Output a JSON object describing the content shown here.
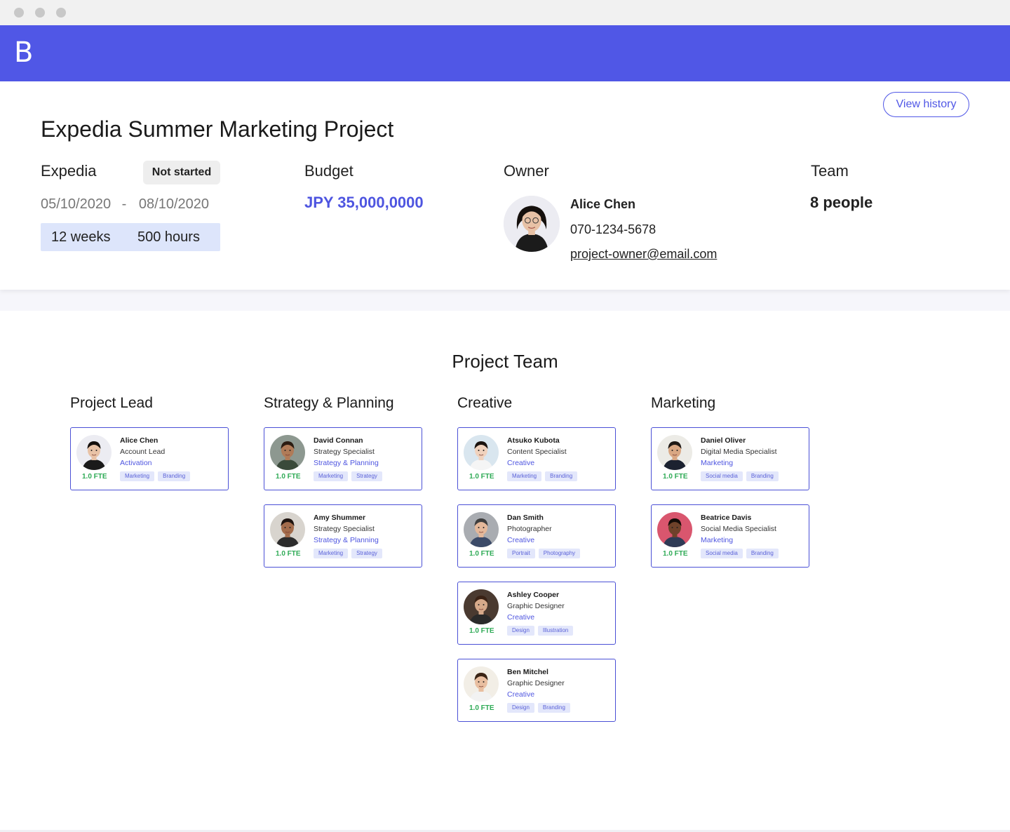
{
  "app": {
    "logo_letter": "B"
  },
  "header": {
    "view_history_label": "View history",
    "title": "Expedia Summer Marketing Project",
    "client": "Expedia",
    "status": "Not started",
    "start_date": "05/10/2020",
    "date_separator": "-",
    "end_date": "08/10/2020",
    "duration_weeks": "12 weeks",
    "duration_hours": "500 hours",
    "budget_label": "Budget",
    "budget_value": "JPY 35,000,0000",
    "owner_label": "Owner",
    "owner_name": "Alice Chen",
    "owner_phone": "070-1234-5678",
    "owner_email": "project-owner@email.com",
    "team_label": "Team",
    "team_count": "8 people"
  },
  "team_section": {
    "title": "Project Team",
    "groups": [
      {
        "name": "Project Lead"
      },
      {
        "name": "Strategy & Planning"
      },
      {
        "name": "Creative"
      },
      {
        "name": "Marketing"
      }
    ],
    "members": [
      {
        "name": "Alice Chen",
        "role": "Account Lead",
        "dept": "Activation",
        "fte": "1.0 FTE",
        "tags": [
          "Marketing",
          "Branding"
        ],
        "skin": "#e8c2a6",
        "hair": "#15100d",
        "shirt": "#1b1b1b",
        "bg": "#ececf2"
      },
      {
        "name": "David Connan",
        "role": "Strategy Specialist",
        "dept": "Strategy & Planning",
        "fte": "1.0 FTE",
        "tags": [
          "Marketing",
          "Strategy"
        ],
        "skin": "#b07b58",
        "hair": "#2b1c12",
        "shirt": "#3a4a3a",
        "bg": "#8d9890"
      },
      {
        "name": "Amy Shummer",
        "role": "Strategy Specialist",
        "dept": "Strategy & Planning",
        "fte": "1.0 FTE",
        "tags": [
          "Marketing",
          "Strategy"
        ],
        "skin": "#a36c4c",
        "hair": "#1e1410",
        "shirt": "#2c2c2c",
        "bg": "#d8d4ce"
      },
      {
        "name": "Atsuko Kubota",
        "role": "Content Specialist",
        "dept": "Creative",
        "fte": "1.0 FTE",
        "tags": [
          "Marketing",
          "Branding"
        ],
        "skin": "#f0d2bd",
        "hair": "#1a120e",
        "shirt": "#f5f5f5",
        "bg": "#d9e6ef"
      },
      {
        "name": "Dan Smith",
        "role": "Photographer",
        "dept": "Creative",
        "fte": "1.0 FTE",
        "tags": [
          "Portrait",
          "Photography"
        ],
        "skin": "#e4b89a",
        "hair": "#3e3e3e",
        "shirt": "#3b4a68",
        "bg": "#a9acb1"
      },
      {
        "name": "Ashley Cooper",
        "role": "Graphic Designer",
        "dept": "Creative",
        "fte": "1.0 FTE",
        "tags": [
          "Design",
          "Illustration"
        ],
        "skin": "#d6a98a",
        "hair": "#3a2215",
        "shirt": "#2a2a2a",
        "bg": "#4a3a30"
      },
      {
        "name": "Ben Mitchel",
        "role": "Graphic Designer",
        "dept": "Creative",
        "fte": "1.0 FTE",
        "tags": [
          "Design",
          "Branding"
        ],
        "skin": "#e8bea0",
        "hair": "#3a2415",
        "shirt": "#f2f2f2",
        "bg": "#f2eee6"
      },
      {
        "name": "Daniel Oliver",
        "role": "Digital Media Specialist",
        "dept": "Marketing",
        "fte": "1.0 FTE",
        "tags": [
          "Social media",
          "Branding"
        ],
        "skin": "#d9a783",
        "hair": "#1f1915",
        "shirt": "#1c2230",
        "bg": "#ecebe6"
      },
      {
        "name": "Beatrice Davis",
        "role": "Social Media Specialist",
        "dept": "Marketing",
        "fte": "1.0 FTE",
        "tags": [
          "Social media",
          "Branding"
        ],
        "skin": "#6e422a",
        "hair": "#140c08",
        "shirt": "#2f3a55",
        "bg": "#d9566e"
      }
    ]
  }
}
